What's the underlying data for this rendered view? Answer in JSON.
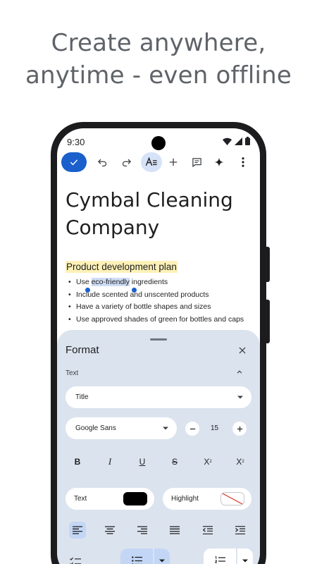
{
  "headline": {
    "line1": "Create anywhere,",
    "line2": "anytime - even offline"
  },
  "status": {
    "time": "9:30"
  },
  "toolbar": {
    "icons": [
      "check-icon",
      "undo-icon",
      "redo-icon",
      "text-format-icon",
      "add-icon",
      "comment-icon",
      "sparkle-icon",
      "more-icon"
    ]
  },
  "document": {
    "title": "Cymbal Cleaning Company",
    "heading": "Product development plan",
    "bullets": [
      {
        "before": "Use ",
        "selected": "eco-friendly",
        "after": " ingredients"
      },
      {
        "text": "Include scented and unscented products"
      },
      {
        "text": "Have a variety of bottle shapes and sizes"
      },
      {
        "text": "Use approved shades of green for bottles and caps"
      }
    ]
  },
  "format_sheet": {
    "title": "Format",
    "section_label": "Text",
    "style_value": "Title",
    "font_value": "Google Sans",
    "font_size": "15",
    "buttons": {
      "bold": "B",
      "italic": "I",
      "underline": "U",
      "strikethrough": "S",
      "superscript": "X",
      "superscript_mark": "2",
      "subscript": "X",
      "subscript_mark": "2"
    },
    "text_color_label": "Text",
    "text_color": "#000000",
    "highlight_label": "Highlight",
    "highlight_value": "none"
  },
  "colors": {
    "accent": "#1a5fcc",
    "sheet_bg": "#dbe3ee",
    "selection": "#cfdcf5",
    "heading_highlight": "#fdf1b8"
  }
}
